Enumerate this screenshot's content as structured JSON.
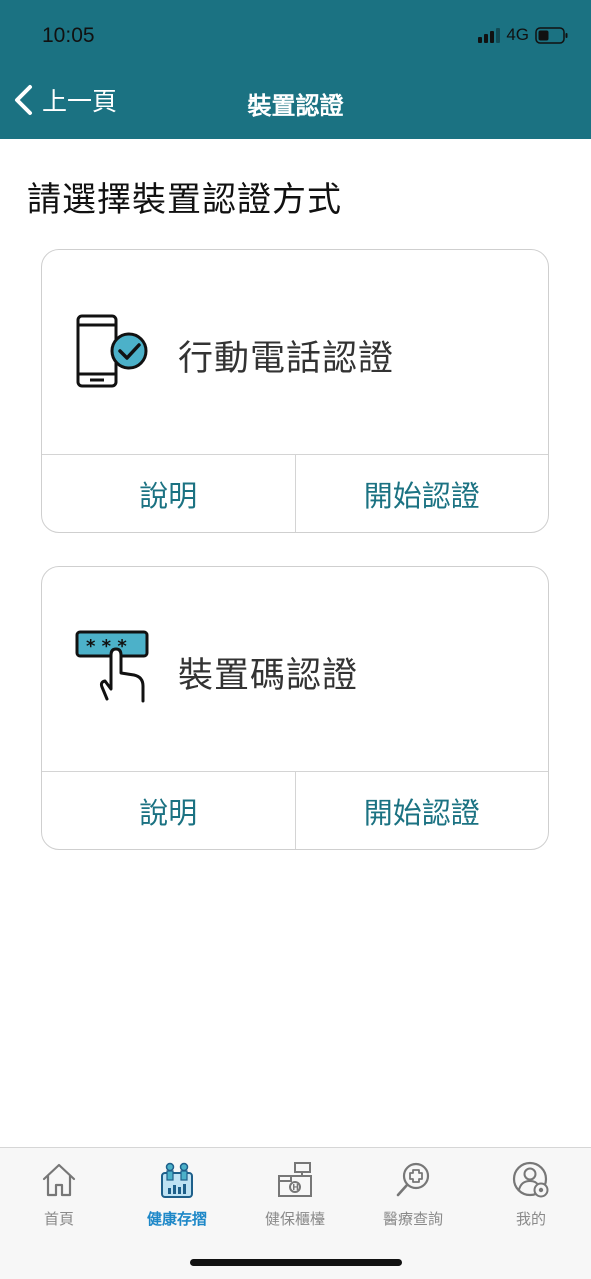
{
  "status_bar": {
    "time": "10:05",
    "network": "4G"
  },
  "nav": {
    "back_label": "上一頁",
    "title": "裝置認證"
  },
  "page": {
    "heading": "請選擇裝置認證方式"
  },
  "cards": [
    {
      "label": "行動電話認證",
      "icon": "phone-check-icon",
      "info_label": "說明",
      "start_label": "開始認證"
    },
    {
      "label": "裝置碼認證",
      "icon": "password-touch-icon",
      "info_label": "說明",
      "start_label": "開始認證"
    }
  ],
  "tabbar": {
    "tabs": [
      {
        "label": "首頁",
        "icon": "home-icon",
        "active": false
      },
      {
        "label": "健康存摺",
        "icon": "health-passbook-icon",
        "active": true
      },
      {
        "label": "健保櫃檯",
        "icon": "counter-icon",
        "active": false
      },
      {
        "label": "醫療查詢",
        "icon": "medical-search-icon",
        "active": false
      },
      {
        "label": "我的",
        "icon": "profile-settings-icon",
        "active": false
      }
    ]
  },
  "colors": {
    "primary": "#1b7282",
    "active_tab": "#1e88c8",
    "accent": "#4cb1c9"
  }
}
